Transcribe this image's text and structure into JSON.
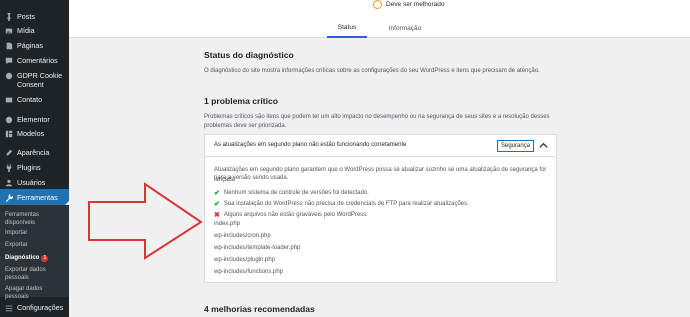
{
  "sidebar": {
    "items": [
      {
        "icon": "pin-icon",
        "label": "Posts"
      },
      {
        "icon": "media-icon",
        "label": "Mídia"
      },
      {
        "icon": "pages-icon",
        "label": "Páginas"
      },
      {
        "icon": "comments-icon",
        "label": "Comentários"
      },
      {
        "icon": "gdpr-cookie-icon",
        "label": "GDPR Cookie Consent"
      },
      {
        "icon": "contact-icon",
        "label": "Contato"
      },
      {
        "icon": "elementor-icon",
        "label": "Elementor"
      },
      {
        "icon": "templates-icon",
        "label": "Modelos"
      },
      {
        "icon": "appearance-icon",
        "label": "Aparência"
      },
      {
        "icon": "plugins-icon",
        "label": "Plugins"
      },
      {
        "icon": "users-icon",
        "label": "Usuários"
      },
      {
        "icon": "tools-icon",
        "label": "Ferramentas"
      }
    ],
    "submenu": [
      {
        "label": "Ferramentas disponíveis"
      },
      {
        "label": "Importar"
      },
      {
        "label": "Exportar"
      },
      {
        "label": "Diagnóstico",
        "badge": "1"
      },
      {
        "label": "Exportar dados pessoais"
      },
      {
        "label": "Apagar dados pessoais"
      }
    ],
    "settings": {
      "icon": "settings-icon",
      "label": "Configurações"
    }
  },
  "header": {
    "score_label": "Deve ser melhorado",
    "tabs": [
      {
        "label": "Status"
      },
      {
        "label": "Informação"
      }
    ]
  },
  "main": {
    "title": "Status do diagnóstico",
    "intro": "O diagnóstico do site mostra informações críticas sobre as configurações do seu WordPress e itens que precisam de atenção.",
    "critical_title": "1 problema crítico",
    "critical_desc_1": "Problemas críticos são itens que podem ter um alto impacto no desempenho ou na segurança de seus sites e a resolução desses",
    "critical_desc_2": "problemas deve ser priorizada.",
    "accordion": {
      "title": "As atualizações em segundo plano não estão funcionando corretamente",
      "badge": "Segurança",
      "text_1": "Atualizações em segundo plano garantem que o WordPress possa se atualizar sozinho se uma atualização de segurança for lançada",
      "text_2": "para a versão sendo usada.",
      "checks": [
        {
          "status": "ok",
          "text": "Nenhum sistema de controle de versões foi detectado."
        },
        {
          "status": "ok",
          "text": "Sua instalação do WordPress não precisa de credenciais de FTP para realizar atualizações."
        },
        {
          "status": "error",
          "text": "Alguns arquivos não estão graváveis pelo WordPress:"
        }
      ],
      "files": [
        "index.php",
        "wp-includes/cron.php",
        "wp-includes/template-loader.php",
        "wp-includes/plugin.php",
        "wp-includes/functions.php"
      ]
    },
    "recommended_title": "4 melhorias recomendadas"
  },
  "colors": {
    "sidebar_bg": "#1d2327",
    "active_menu": "#2271b1",
    "badge": "#d63638",
    "ok": "#00a32a",
    "error": "#d63638",
    "arrow": "#d63638"
  }
}
